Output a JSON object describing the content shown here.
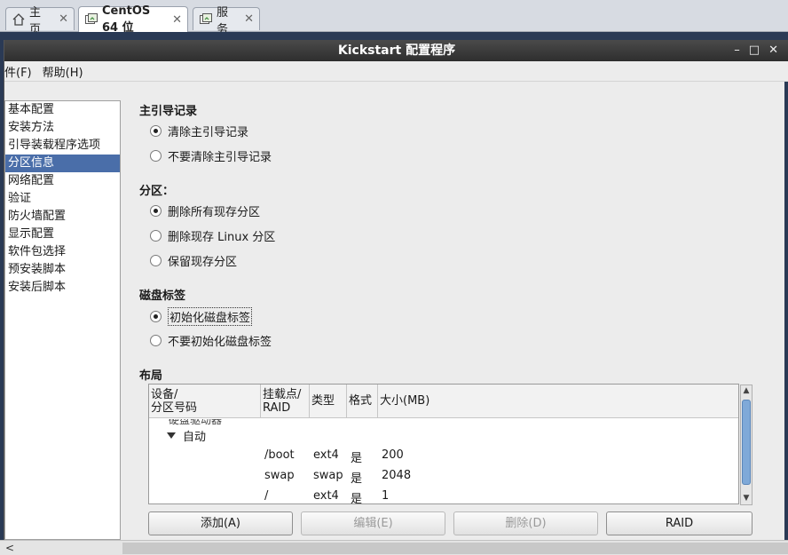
{
  "vm_tabs": [
    {
      "label": "主页",
      "icon": "home-icon",
      "active": false
    },
    {
      "label": "CentOS 64 位",
      "icon": "vm-icon",
      "active": true
    },
    {
      "label": "服务",
      "icon": "vm-icon",
      "active": false
    }
  ],
  "window": {
    "title": "Kickstart 配置程序",
    "controls": {
      "minimize": "–",
      "maximize": "□",
      "close": "✕"
    }
  },
  "menu": {
    "file": "件(F)",
    "help": "帮助(H)"
  },
  "sidebar": {
    "items": [
      "基本配置",
      "安装方法",
      "引导装载程序选项",
      "分区信息",
      "网络配置",
      "验证",
      "防火墙配置",
      "显示配置",
      "软件包选择",
      "预安装脚本",
      "安装后脚本"
    ],
    "selected_index": 3
  },
  "mbr": {
    "title": "主引导记录",
    "options": [
      "清除主引导记录",
      "不要清除主引导记录"
    ],
    "selected": 0
  },
  "partitions": {
    "title": "分区：",
    "options": [
      "删除所有现存分区",
      "删除现存 Linux 分区",
      "保留现存分区"
    ],
    "selected": 0
  },
  "disklabel": {
    "title": "磁盘标签",
    "options": [
      "初始化磁盘标签",
      "不要初始化磁盘标签"
    ],
    "selected": 0
  },
  "layout": {
    "title": "布局",
    "columns": [
      {
        "line1": "设备/",
        "line2": "分区号码"
      },
      {
        "line1": "挂载点/",
        "line2": "RAID"
      },
      {
        "line1": "类型",
        "line2": ""
      },
      {
        "line1": "格式",
        "line2": ""
      },
      {
        "line1": "大小(MB)",
        "line2": ""
      }
    ],
    "cut_row_text": "硬盘驱动器",
    "tree_node": "自动",
    "rows": [
      {
        "mount": "/boot",
        "type": "ext4",
        "format": "是",
        "size": "200"
      },
      {
        "mount": "swap",
        "type": "swap",
        "format": "是",
        "size": "2048"
      },
      {
        "mount": "/",
        "type": "ext4",
        "format": "是",
        "size": "1"
      }
    ]
  },
  "buttons": {
    "add": "添加(A)",
    "edit": "编辑(E)",
    "delete": "删除(D)",
    "raid": "RAID"
  },
  "colors": {
    "selection": "#4a6ea9",
    "scroll_thumb": "#7fa9d8",
    "titlebar": "#3a3a3a"
  }
}
